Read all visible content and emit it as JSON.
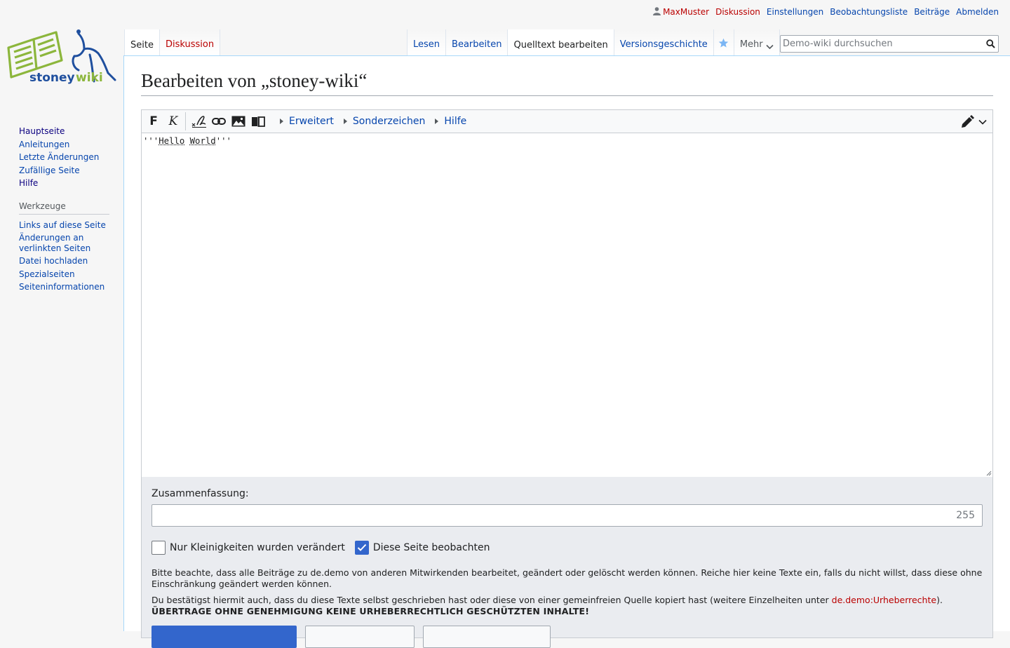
{
  "personal": {
    "username": "MaxMuster",
    "talk": "Diskussion",
    "preferences": "Einstellungen",
    "watchlist": "Beobachtungsliste",
    "contributions": "Beiträge",
    "logout": "Abmelden"
  },
  "logo": {
    "text_a": "stoney",
    "text_b": "wiki",
    "color_green": "#8cb63c",
    "color_blue": "#1f4f9e"
  },
  "tabs": {
    "page": "Seite",
    "discussion": "Diskussion",
    "read": "Lesen",
    "edit": "Bearbeiten",
    "edit_source": "Quelltext bearbeiten",
    "history": "Versionsgeschichte",
    "more": "Mehr"
  },
  "search": {
    "placeholder": "Demo-wiki durchsuchen"
  },
  "sidebar": {
    "navigation": [
      "Hauptseite",
      "Anleitungen",
      "Letzte Änderungen",
      "Zufällige Seite",
      "Hilfe"
    ],
    "tools_heading": "Werkzeuge",
    "tools": [
      "Links auf diese Seite",
      "Änderungen an verlinkten Seiten",
      "Datei hochladen",
      "Spezialseiten",
      "Seiteninformationen"
    ]
  },
  "page": {
    "heading": "Bearbeiten von „stoney-wiki“"
  },
  "toolbar": {
    "bold": "F",
    "italic": "K",
    "advanced": "Erweitert",
    "special_chars": "Sonderzeichen",
    "help": "Hilfe"
  },
  "editor": {
    "content_prefix": "'''",
    "word1": "Hello",
    "space": " ",
    "word2": "World",
    "content_suffix": "'''"
  },
  "summary": {
    "label": "Zusammenfassung:",
    "value": "",
    "count": "255"
  },
  "options": {
    "minor_label": "Nur Kleinigkeiten wurden verändert",
    "minor_checked": false,
    "watch_label": "Diese Seite beobachten",
    "watch_checked": true
  },
  "notices": {
    "license": "Bitte beachte, dass alle Beiträge zu de.demo von anderen Mitwirkenden bearbeitet, geändert oder gelöscht werden können. Reiche hier keine Texte ein, falls du nicht willst, dass diese ohne Einschränkung geändert werden können.",
    "confirm_before": "Du bestätigst hiermit auch, dass du diese Texte selbst geschrieben hast oder diese von einer gemeinfreien Quelle kopiert hast (weitere Einzelheiten unter ",
    "copyright_link": "de.demo:Urheberrechte",
    "confirm_after": ").",
    "warning": "ÜBERTRAGE OHNE GENEHMIGUNG KEINE URHEBERRECHTLICH GESCHÜTZTEN INHALTE!"
  },
  "colors": {
    "link": "#0645ad",
    "new_link": "#ba0000",
    "primary": "#3366cc",
    "border_blue": "#a7d7f9"
  }
}
